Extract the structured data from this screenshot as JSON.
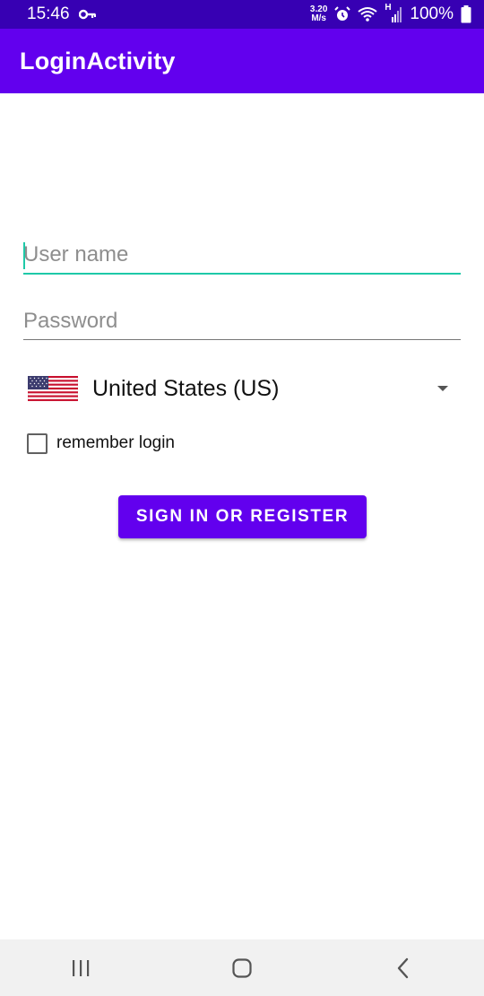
{
  "status_bar": {
    "time": "15:46",
    "net_speed_value": "3.20",
    "net_speed_unit": "M/s",
    "network_type": "H",
    "battery": "100%",
    "icons": [
      "key-icon",
      "alarm-icon",
      "wifi-icon",
      "signal-icon",
      "battery-icon"
    ]
  },
  "app_bar": {
    "title": "LoginActivity"
  },
  "form": {
    "username_placeholder": "User name",
    "password_placeholder": "Password",
    "country": {
      "selected": "United States (US)",
      "flag": "us-flag-icon"
    },
    "remember_label": "remember login",
    "remember_checked": false,
    "submit_label": "SIGN IN OR REGISTER"
  },
  "nav_bar": {
    "icons": [
      "recent-apps-icon",
      "home-icon",
      "back-icon"
    ]
  },
  "colors": {
    "status_bar": "#3700b3",
    "primary": "#6200ee",
    "accent": "#1ec9a8"
  }
}
